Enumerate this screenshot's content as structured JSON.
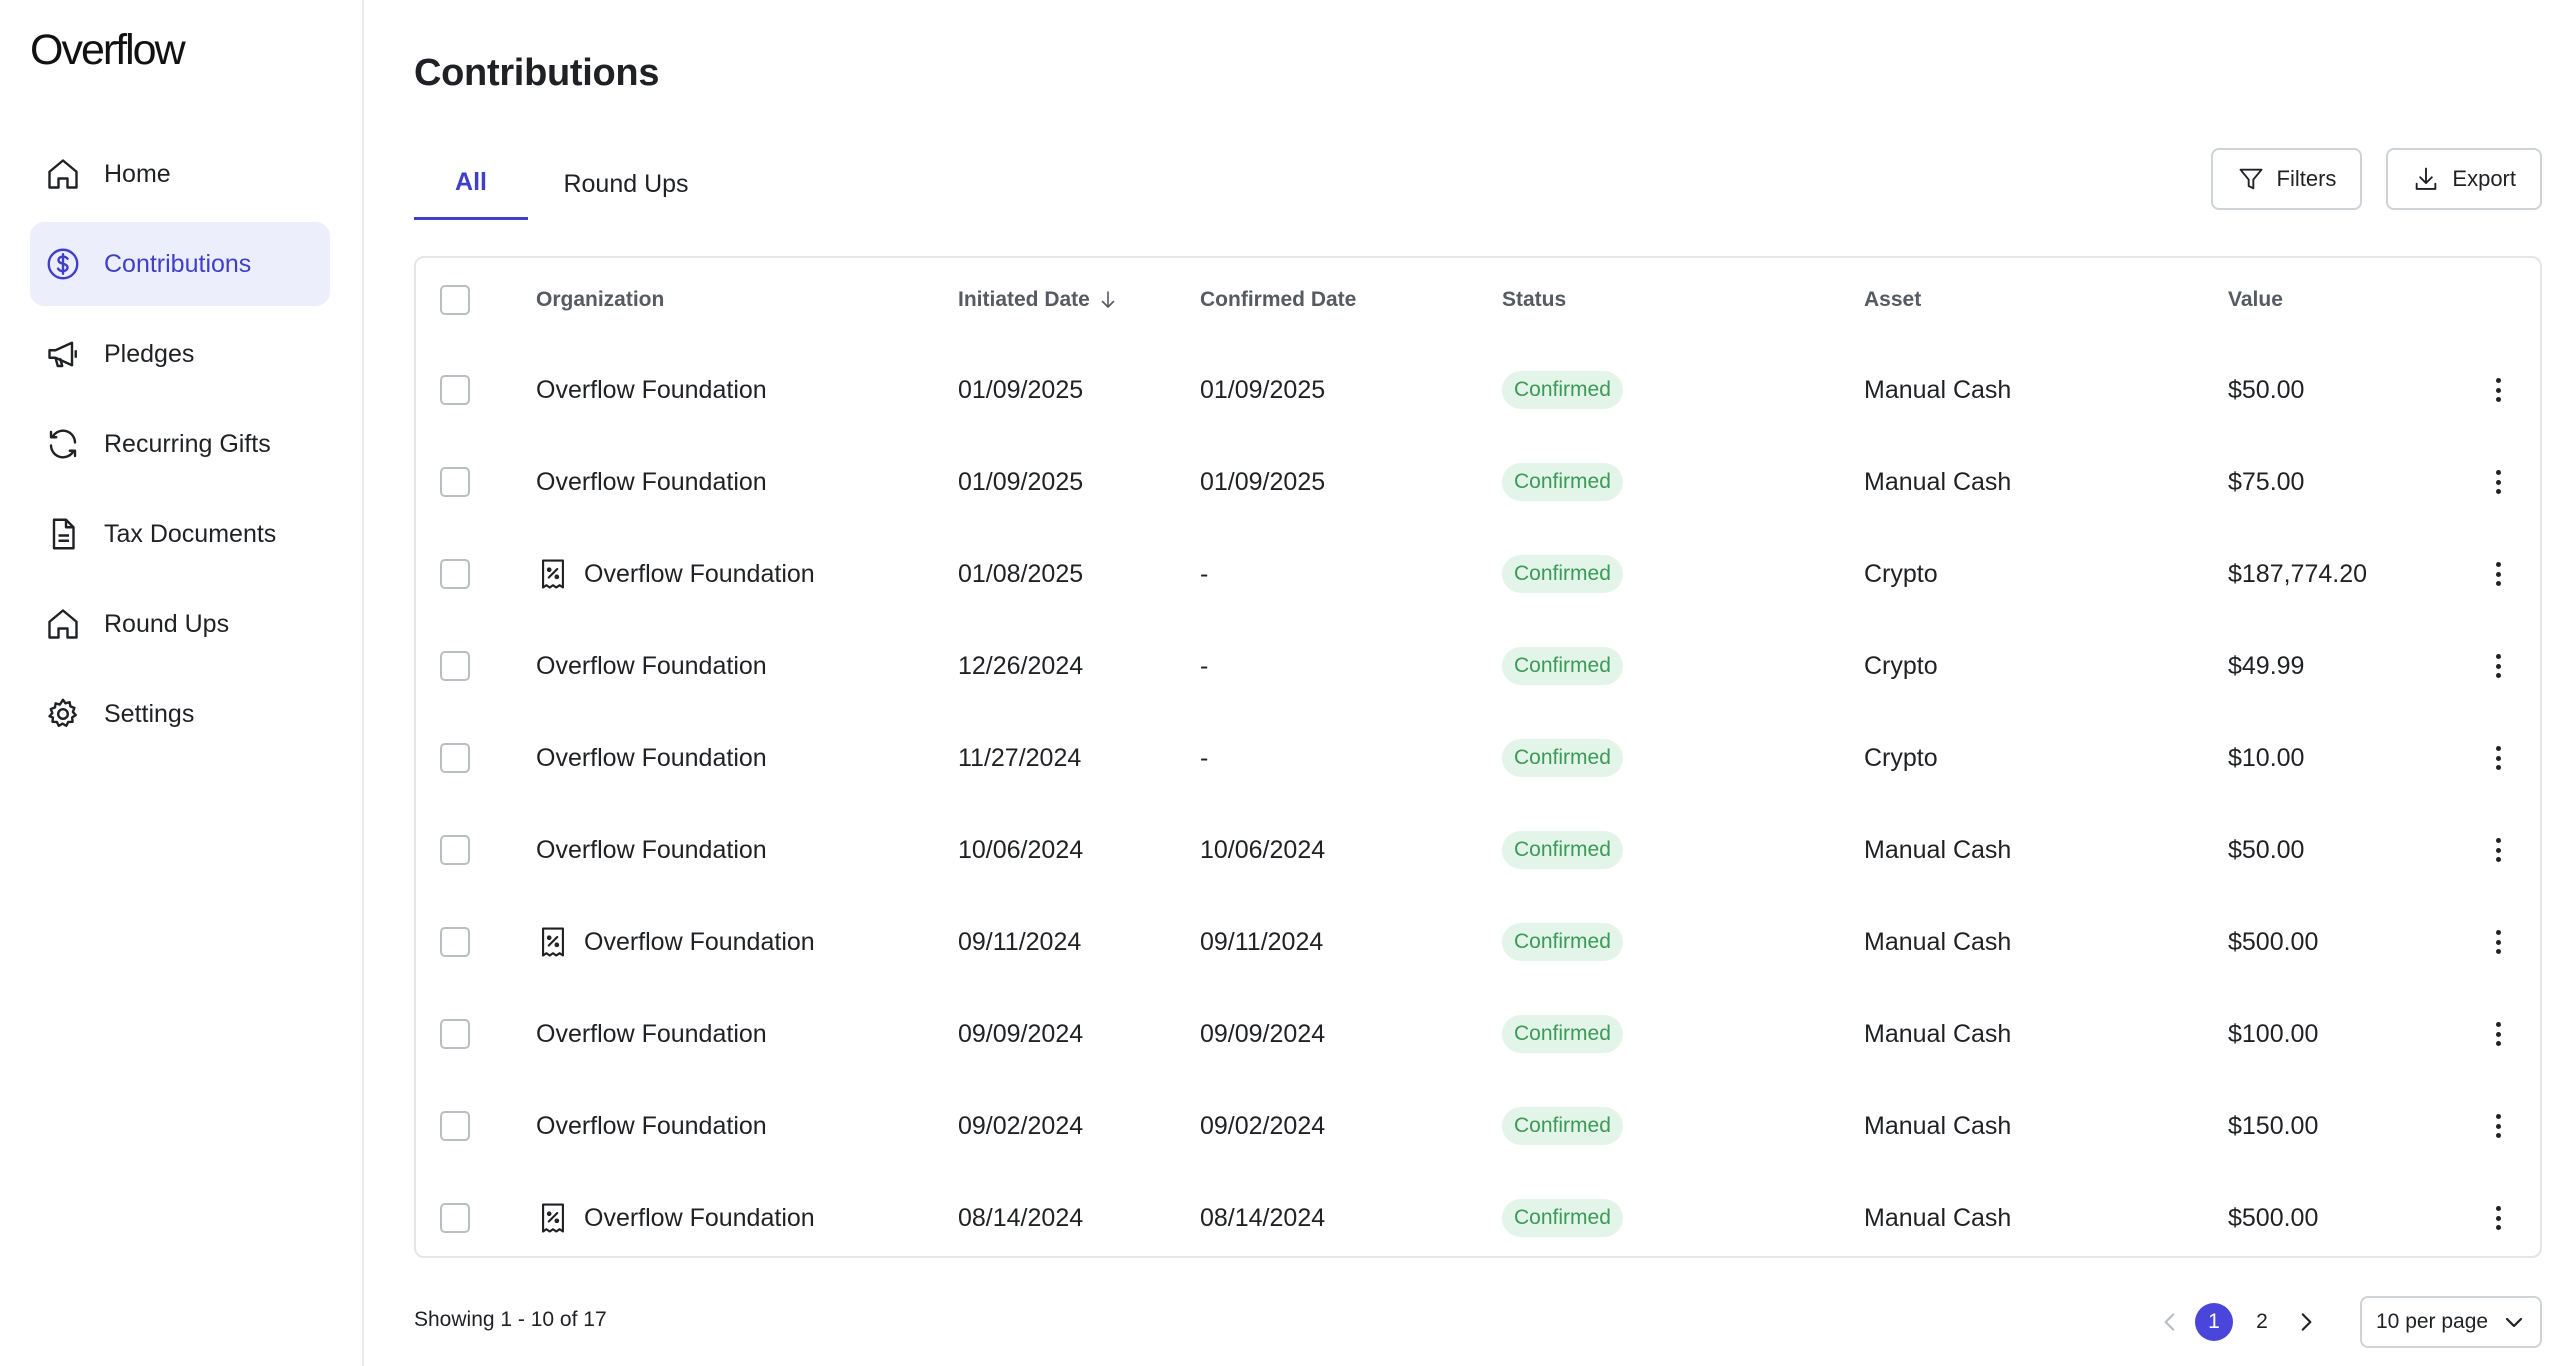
{
  "app": {
    "logo": "Overflow"
  },
  "sidebar": {
    "items": [
      {
        "label": "Home",
        "icon": "home-icon",
        "active": false
      },
      {
        "label": "Contributions",
        "icon": "dollar-circle-icon",
        "active": true
      },
      {
        "label": "Pledges",
        "icon": "megaphone-icon",
        "active": false
      },
      {
        "label": "Recurring Gifts",
        "icon": "refresh-icon",
        "active": false
      },
      {
        "label": "Tax Documents",
        "icon": "document-icon",
        "active": false
      },
      {
        "label": "Round Ups",
        "icon": "home-icon",
        "active": false
      },
      {
        "label": "Settings",
        "icon": "gear-icon",
        "active": false
      }
    ]
  },
  "page": {
    "title": "Contributions"
  },
  "tabs": [
    {
      "label": "All",
      "active": true
    },
    {
      "label": "Round Ups",
      "active": false
    }
  ],
  "toolbar": {
    "filters_label": "Filters",
    "export_label": "Export"
  },
  "table": {
    "columns": {
      "organization": "Organization",
      "initiated": "Initiated Date",
      "confirmed": "Confirmed Date",
      "status": "Status",
      "asset": "Asset",
      "value": "Value"
    },
    "sort_icon": "arrow-down-icon",
    "rows": [
      {
        "org": "Overflow Foundation",
        "receipt": false,
        "initiated": "01/09/2025",
        "confirmed": "01/09/2025",
        "status": "Confirmed",
        "asset": "Manual Cash",
        "value": "$50.00"
      },
      {
        "org": "Overflow Foundation",
        "receipt": false,
        "initiated": "01/09/2025",
        "confirmed": "01/09/2025",
        "status": "Confirmed",
        "asset": "Manual Cash",
        "value": "$75.00"
      },
      {
        "org": "Overflow Foundation",
        "receipt": true,
        "initiated": "01/08/2025",
        "confirmed": "-",
        "status": "Confirmed",
        "asset": "Crypto",
        "value": "$187,774.20"
      },
      {
        "org": "Overflow Foundation",
        "receipt": false,
        "initiated": "12/26/2024",
        "confirmed": "-",
        "status": "Confirmed",
        "asset": "Crypto",
        "value": "$49.99"
      },
      {
        "org": "Overflow Foundation",
        "receipt": false,
        "initiated": "11/27/2024",
        "confirmed": "-",
        "status": "Confirmed",
        "asset": "Crypto",
        "value": "$10.00"
      },
      {
        "org": "Overflow Foundation",
        "receipt": false,
        "initiated": "10/06/2024",
        "confirmed": "10/06/2024",
        "status": "Confirmed",
        "asset": "Manual Cash",
        "value": "$50.00"
      },
      {
        "org": "Overflow Foundation",
        "receipt": true,
        "initiated": "09/11/2024",
        "confirmed": "09/11/2024",
        "status": "Confirmed",
        "asset": "Manual Cash",
        "value": "$500.00"
      },
      {
        "org": "Overflow Foundation",
        "receipt": false,
        "initiated": "09/09/2024",
        "confirmed": "09/09/2024",
        "status": "Confirmed",
        "asset": "Manual Cash",
        "value": "$100.00"
      },
      {
        "org": "Overflow Foundation",
        "receipt": false,
        "initiated": "09/02/2024",
        "confirmed": "09/02/2024",
        "status": "Confirmed",
        "asset": "Manual Cash",
        "value": "$150.00"
      },
      {
        "org": "Overflow Foundation",
        "receipt": true,
        "initiated": "08/14/2024",
        "confirmed": "08/14/2024",
        "status": "Confirmed",
        "asset": "Manual Cash",
        "value": "$500.00"
      }
    ]
  },
  "footer": {
    "showing": "Showing 1 - 10 of 17",
    "pages": [
      "1",
      "2"
    ],
    "current_page": "1",
    "per_page": "10 per page"
  },
  "colors": {
    "accent": "#3f3fc8",
    "accent_bg": "#eceefc",
    "status_confirmed_bg": "#e3f4e8",
    "status_confirmed_text": "#3a9a58"
  }
}
